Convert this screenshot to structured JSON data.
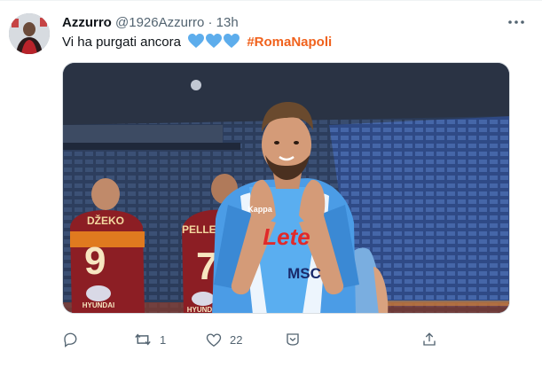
{
  "tweet": {
    "author_name": "Azzurro",
    "author_handle": "@1926Azzurro",
    "separator": "·",
    "time": "13h",
    "text": "Vi ha purgati ancora",
    "emoji": [
      "blue-heart",
      "blue-heart",
      "blue-heart"
    ],
    "hashtag": "#RomaNapoli",
    "image": {
      "shirt_text_sponsor": "Lete",
      "shirt_text_msc": "MSC",
      "shirt_brand": "Kappa",
      "roma_player_1_name": "DŽEKO",
      "roma_player_1_number": "9",
      "roma_player_2_name": "PELLEGRINI",
      "roma_player_2_number": "7",
      "roma_sponsor": "HYUNDAI"
    }
  },
  "actions": {
    "reply_count": "",
    "retweet_count": "1",
    "like_count": "22"
  },
  "colors": {
    "hashtag": "#f0621d",
    "heart": "#5dadec",
    "secondary_text": "#536471"
  }
}
